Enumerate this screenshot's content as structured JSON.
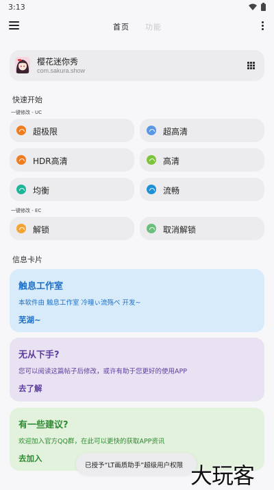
{
  "status_bar": {
    "time": "3:13",
    "icons": [
      "wifi-icon",
      "battery-icon"
    ]
  },
  "app_bar": {
    "menu_icon": "menu-icon",
    "tabs": [
      {
        "label": "首页",
        "active": true
      },
      {
        "label": "功能",
        "active": false
      }
    ],
    "more_icon": "more-vertical-icon"
  },
  "app_card": {
    "name": "樱花迷你秀",
    "package": "com.sakura.show",
    "grid_icon": "grid-icon"
  },
  "quick_start": {
    "title": "快速开始",
    "uc_label": "一键修改 - UC",
    "uc_options": [
      {
        "label": "超极限",
        "color": "#ef7c1f"
      },
      {
        "label": "超高清",
        "color": "#5a97e5"
      },
      {
        "label": "HDR高清",
        "color": "#ef7c1f"
      },
      {
        "label": "高清",
        "color": "#7dc43a"
      },
      {
        "label": "均衡",
        "color": "#1fb59a"
      },
      {
        "label": "流畅",
        "color": "#1e90d6"
      }
    ],
    "ec_label": "一键修改 - EC",
    "ec_options": [
      {
        "label": "解锁",
        "color": "#f2a534"
      },
      {
        "label": "取消解锁",
        "color": "#6abf7d"
      }
    ]
  },
  "info_cards": {
    "title": "信息卡片",
    "cards": [
      {
        "title": "触息工作室",
        "desc": "本软件由 触息工作室 冷曈ぃ流殇べ 开发~",
        "action": "芜湖~",
        "bg": "#d7ebfb",
        "color": "#1f6fc4"
      },
      {
        "title": "无从下手?",
        "desc": "您可以阅读这篇帖子后修改，或许有助于您更好的使用APP",
        "action": "去了解",
        "bg": "#e8e2f3",
        "color": "#5e3e9c"
      },
      {
        "title": "有一些建议?",
        "desc": "欢迎加入官方QQ群，在此可以更快的获取APP资讯",
        "action": "去加入",
        "bg": "#e2f2dd",
        "color": "#2f8a32"
      }
    ]
  },
  "toast": {
    "text": "已授予“LT画质助手”超级用户权限"
  },
  "watermark": {
    "text": "大玩客"
  }
}
